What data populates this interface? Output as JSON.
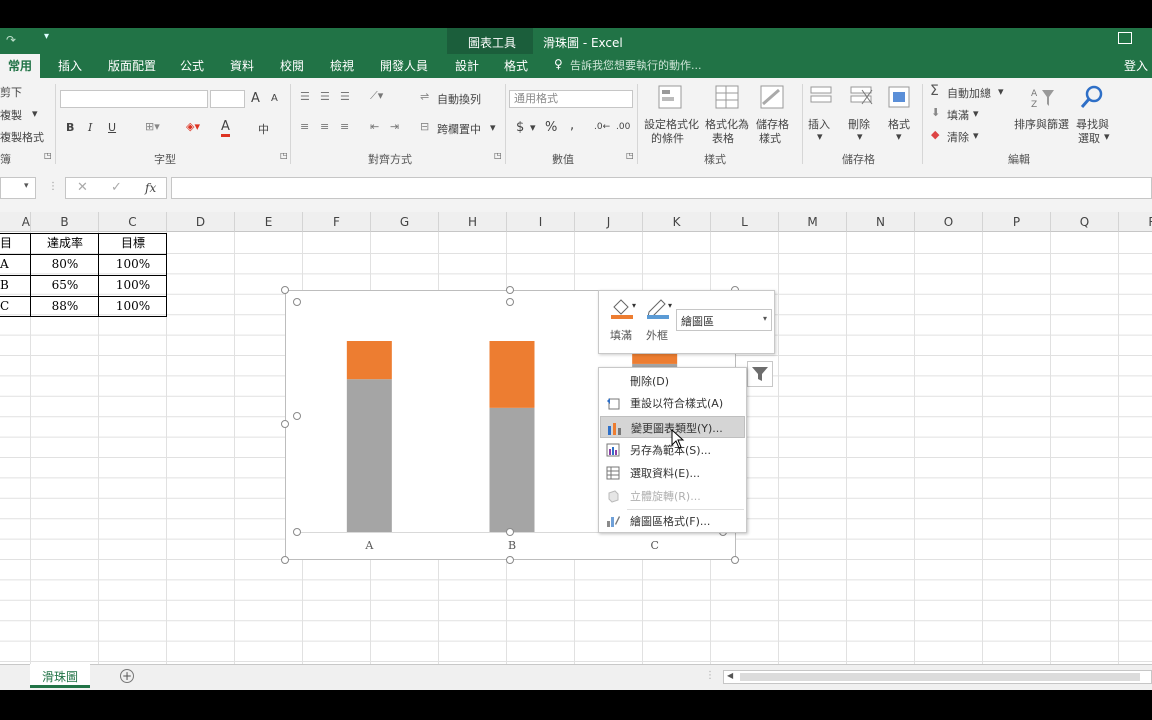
{
  "window": {
    "context_tab_title": "圖表工具",
    "document_title": "滑珠圖 - Excel",
    "signin": "登入"
  },
  "ribbon_tabs": [
    {
      "label": "常用",
      "active": true
    },
    {
      "label": "插入"
    },
    {
      "label": "版面配置"
    },
    {
      "label": "公式"
    },
    {
      "label": "資料"
    },
    {
      "label": "校閱"
    },
    {
      "label": "檢視"
    },
    {
      "label": "開發人員"
    },
    {
      "label": "設計"
    },
    {
      "label": "格式"
    }
  ],
  "tell_me": "告訴我您想要執行的動作...",
  "clipboard": {
    "cut": "剪下",
    "copy": "複製",
    "format_painter": "複製格式",
    "group_fragment": "簿"
  },
  "font": {
    "group": "字型",
    "bold": "B",
    "italic": "I",
    "underline": "U",
    "font_a": "A",
    "grow": "A",
    "shrink": "A",
    "phonetic": "中"
  },
  "alignment": {
    "group": "對齊方式",
    "wrap": "自動換列",
    "merge": "跨欄置中"
  },
  "number": {
    "group": "數值",
    "format": "通用格式",
    "currency": "$",
    "percent": "%",
    "comma": ","
  },
  "styles": {
    "group": "樣式",
    "conditional": "設定格式化的條件",
    "conditional_line1": "設定格式化",
    "conditional_line2": "的條件",
    "table_line1": "格式化為",
    "table_line2": "表格",
    "cell_line1": "儲存格",
    "cell_line2": "樣式"
  },
  "cells": {
    "group": "儲存格",
    "insert": "插入",
    "delete": "刪除",
    "format": "格式"
  },
  "editing": {
    "group": "編輯",
    "autosum": "自動加總",
    "fill": "填滿",
    "clear": "清除",
    "sort": "排序與篩選",
    "find_line1": "尋找與",
    "find_line2": "選取"
  },
  "formula_bar": {
    "cancel": "✕",
    "enter": "✓",
    "fx": "fx"
  },
  "columns": [
    "A",
    "B",
    "C",
    "D",
    "E",
    "F",
    "G",
    "H",
    "I",
    "J",
    "K",
    "L",
    "M",
    "N",
    "O",
    "P",
    "Q",
    "R"
  ],
  "table": {
    "header": [
      "目",
      "達成率",
      "目標"
    ],
    "rows": [
      [
        "A",
        "80%",
        "100%"
      ],
      [
        "B",
        "65%",
        "100%"
      ],
      [
        "C",
        "88%",
        "100%"
      ]
    ]
  },
  "mini_toolbar": {
    "fill": "填滿",
    "outline": "外框",
    "element": "繪圖區"
  },
  "context_menu": [
    {
      "label": "刪除(D)",
      "icon": "none"
    },
    {
      "label": "重設以符合樣式(A)",
      "icon": "reset-icon"
    },
    {
      "label": "變更圖表類型(Y)...",
      "icon": "chart-type-icon",
      "highlighted": true
    },
    {
      "label": "另存為範本(S)...",
      "icon": "template-icon"
    },
    {
      "label": "選取資料(E)...",
      "icon": "select-data-icon"
    },
    {
      "label": "立體旋轉(R)...",
      "icon": "rotate-icon",
      "disabled": true
    },
    {
      "label": "繪圖區格式(F)...",
      "icon": "format-area-icon"
    }
  ],
  "sheet_tab": "滑珠圖",
  "colors": {
    "excel_green": "#217346",
    "achieved": "#a5a5a5",
    "remaining": "#ed7d31"
  },
  "chart_data": {
    "type": "bar",
    "stacked": true,
    "categories": [
      "A",
      "B",
      "C"
    ],
    "series": [
      {
        "values": [
          80,
          65,
          88
        ],
        "color": "#a5a5a5"
      },
      {
        "values": [
          20,
          35,
          12
        ],
        "color": "#ed7d31"
      }
    ],
    "ylim": [
      0,
      100
    ],
    "grid": false,
    "legend": "none"
  }
}
